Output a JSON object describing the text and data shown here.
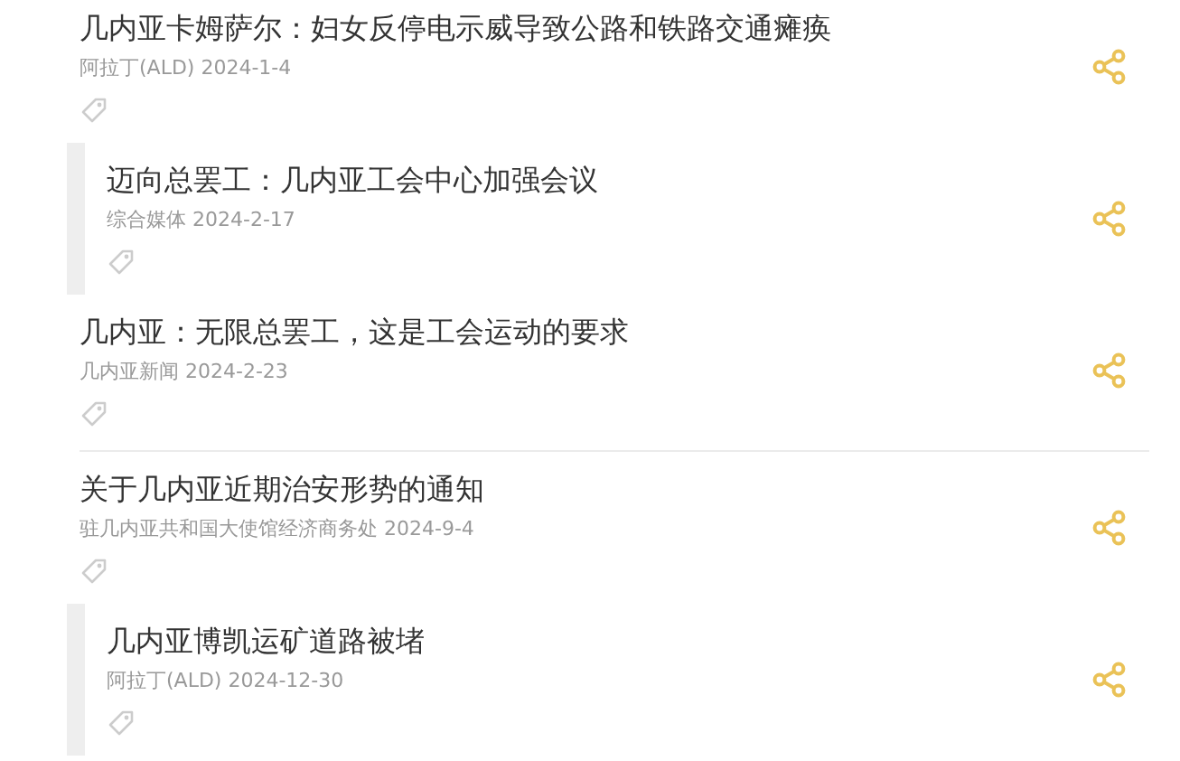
{
  "articles": [
    {
      "kind": "plain",
      "title": "几内亚卡姆萨尔：妇女反停电示威导致公路和铁路交通瘫痪",
      "source": "阿拉丁(ALD)",
      "date": "2024-1-4",
      "divider_below": false
    },
    {
      "kind": "bordered",
      "title": "迈向总罢工：几内亚工会中心加强会议",
      "source": "综合媒体",
      "date": "2024-2-17",
      "divider_below": false
    },
    {
      "kind": "plain",
      "title": "几内亚：无限总罢工，这是工会运动的要求",
      "source": "几内亚新闻",
      "date": "2024-2-23",
      "divider_below": true
    },
    {
      "kind": "plain",
      "title": "关于几内亚近期治安形势的通知",
      "source": "驻几内亚共和国大使馆经济商务处",
      "date": "2024-9-4",
      "divider_below": false
    },
    {
      "kind": "bordered",
      "title": "几内亚博凯运矿道路被堵",
      "source": "阿拉丁(ALD)",
      "date": "2024-12-30",
      "divider_below": false
    }
  ]
}
